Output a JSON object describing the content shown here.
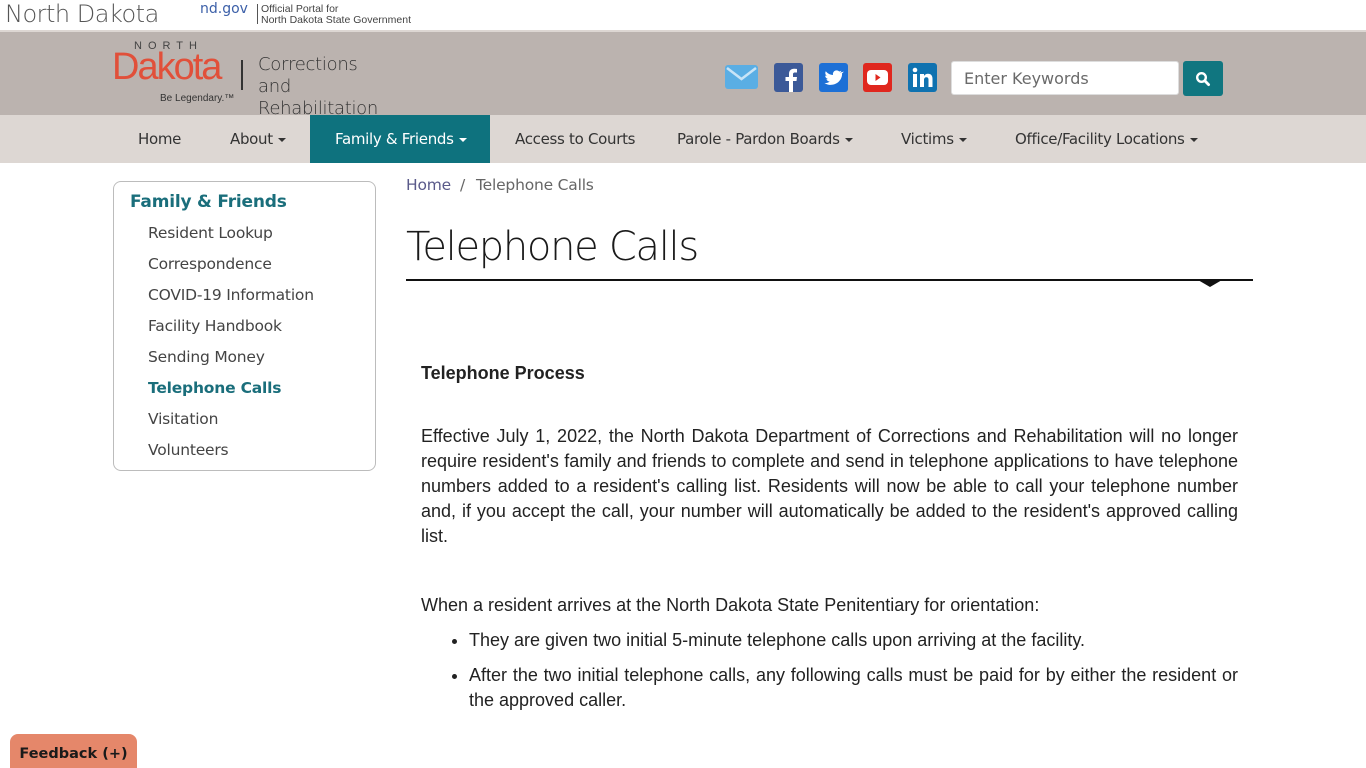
{
  "portal": {
    "state_name": "North Dakota",
    "nd_gov": "nd.gov",
    "tagline_line1": "Official Portal for",
    "tagline_line2": "North Dakota State Government"
  },
  "header": {
    "logo": {
      "north": "NORTH",
      "dakota": "Dakota",
      "slogan": "Be Legendary.™",
      "org_line1": "Corrections and",
      "org_line2": "Rehabilitation"
    },
    "social": [
      {
        "name": "email-icon",
        "color": "#5aaee4"
      },
      {
        "name": "facebook-icon",
        "color": "#3b5998"
      },
      {
        "name": "twitter-icon",
        "color": "#1d70d6"
      },
      {
        "name": "youtube-icon",
        "color": "#e0271e"
      },
      {
        "name": "linkedin-icon",
        "color": "#0f72b0"
      }
    ],
    "search": {
      "placeholder": "Enter Keywords",
      "value": "",
      "button_icon": "search-icon"
    }
  },
  "nav": {
    "items": [
      {
        "label": "Home",
        "dropdown": false
      },
      {
        "label": "About",
        "dropdown": true
      },
      {
        "label": "Family & Friends",
        "dropdown": true,
        "active": true
      },
      {
        "label": "Access to Courts",
        "dropdown": false
      },
      {
        "label": "Parole - Pardon Boards",
        "dropdown": true
      },
      {
        "label": "Victims",
        "dropdown": true
      },
      {
        "label": "Office/Facility Locations",
        "dropdown": true
      }
    ]
  },
  "sidebar": {
    "title": "Family & Friends",
    "items": [
      {
        "label": "Resident Lookup"
      },
      {
        "label": "Correspondence"
      },
      {
        "label": "COVID-19 Information"
      },
      {
        "label": "Facility Handbook"
      },
      {
        "label": "Sending Money"
      },
      {
        "label": "Telephone Calls",
        "active": true
      },
      {
        "label": "Visitation"
      },
      {
        "label": "Volunteers"
      }
    ]
  },
  "breadcrumb": {
    "home": "Home",
    "separator": "/",
    "current": "Telephone Calls"
  },
  "main": {
    "title": "Telephone Calls",
    "section_heading": "Telephone Process",
    "paragraph1": "Effective July 1, 2022, the North Dakota Department of Corrections and Rehabilitation will no longer require resident's family and friends to complete and send in telephone applications to have telephone numbers added to a resident's calling list. Residents will now be able to call your telephone number and, if you accept the call, your number will automatically be added to the resident's approved calling list.",
    "paragraph2": "When a resident arrives at the North Dakota State Penitentiary for orientation:",
    "bullets": [
      "They are given two initial 5-minute telephone calls upon arriving at the facility.",
      "After the two initial telephone calls, any following calls must be paid for by either the resident or the approved caller."
    ]
  },
  "feedback": {
    "label": "Feedback (+)"
  },
  "colors": {
    "accent_teal": "#0e727e",
    "header_bg": "#bbb3af",
    "nav_bg": "#ddd7d3",
    "logo_red": "#e1503a",
    "feedback_bg": "#e5876a"
  }
}
